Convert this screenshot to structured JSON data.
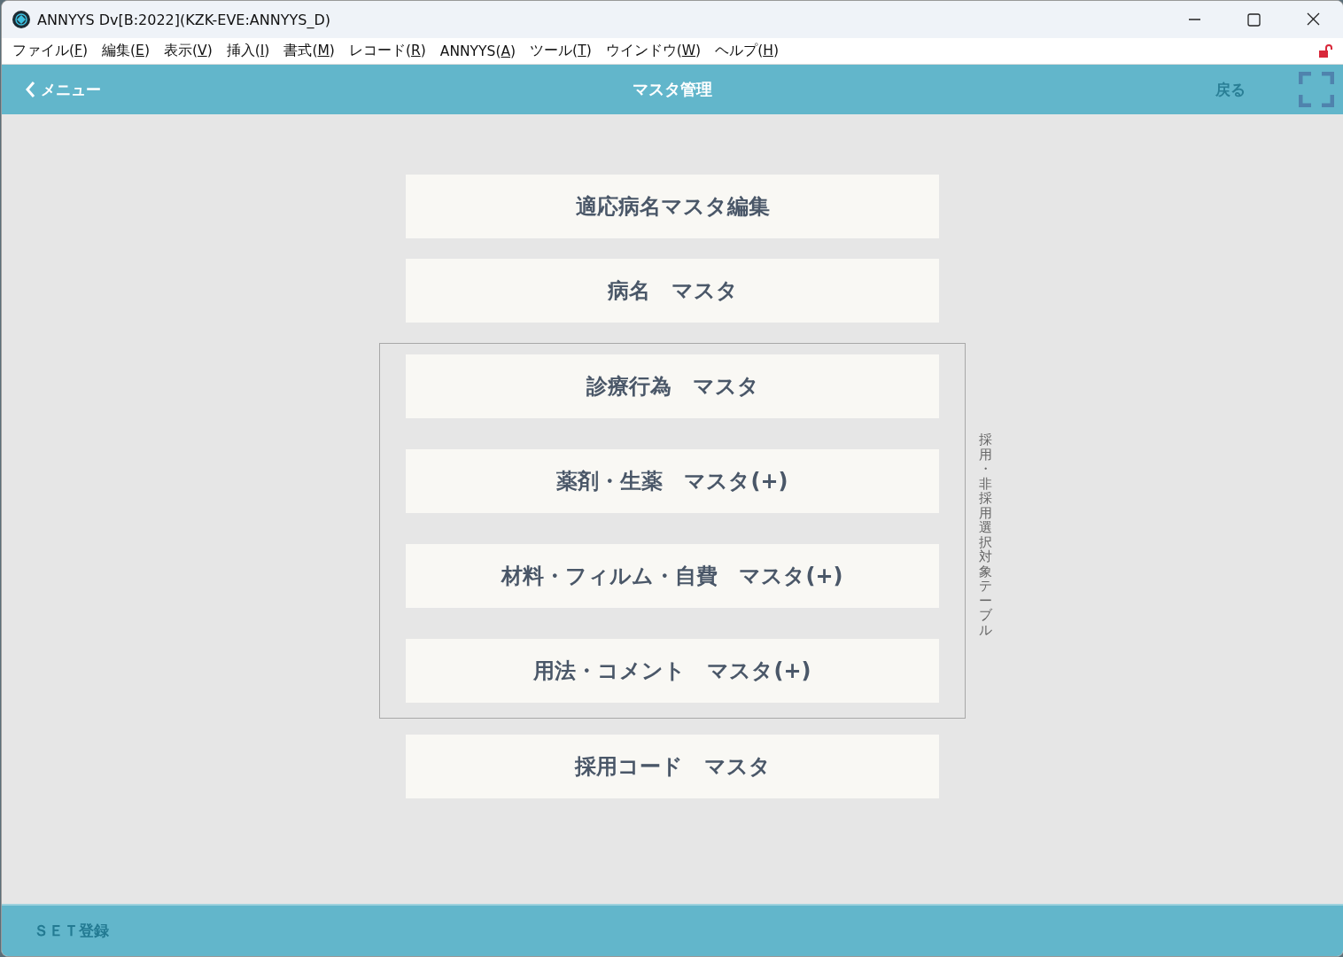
{
  "window": {
    "title": "ANNYYS Dv[B:2022](KZK-EVE:ANNYYS_D)"
  },
  "menu": [
    "ファイル(F)",
    "編集(E)",
    "表示(V)",
    "挿入(I)",
    "書式(M)",
    "レコード(R)",
    "ANNYYS(A)",
    "ツール(T)",
    "ウインドウ(W)",
    "ヘルプ(H)"
  ],
  "header": {
    "back": "メニュー",
    "title": "マスタ管理",
    "return": {
      "label": "戻る",
      "disabled": true
    }
  },
  "sections": [
    {
      "kind": "plain",
      "buttons": [
        "適応病名マスタ編集",
        "病名　マスタ"
      ]
    },
    {
      "kind": "group",
      "side_label": "採用・非採用選択対象テーブル",
      "buttons": [
        "診療行為　マスタ",
        "薬剤・生薬　マスタ(+)",
        "材料・フィルム・自費　マスタ(+)",
        "用法・コメント　マスタ(+)"
      ]
    },
    {
      "kind": "plain",
      "buttons": [
        "採用コード　マスタ"
      ]
    }
  ],
  "footer": {
    "button": {
      "label": "ＳＥＴ登録",
      "disabled": true
    }
  }
}
